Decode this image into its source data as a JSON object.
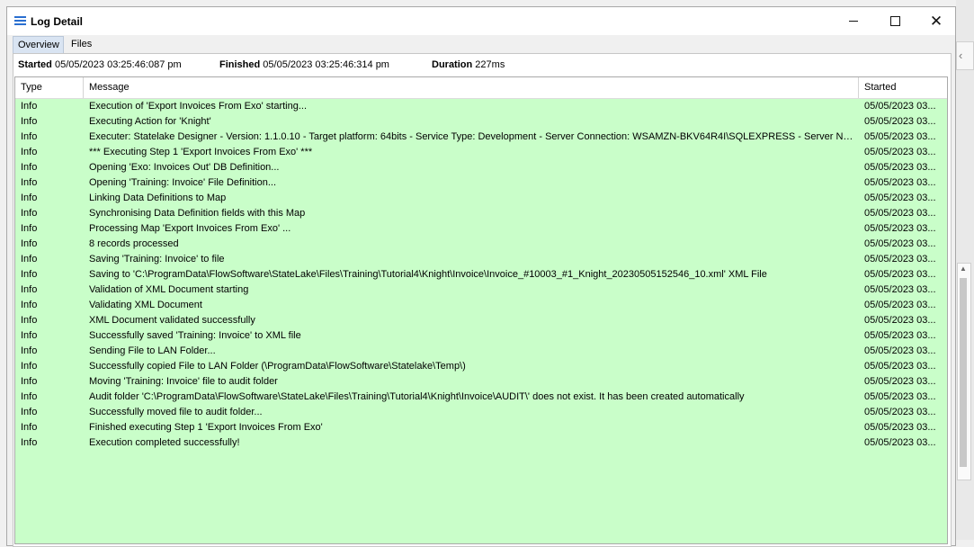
{
  "window": {
    "title": "Log Detail"
  },
  "tabs": [
    {
      "label": "Overview"
    },
    {
      "label": "Files"
    }
  ],
  "summary": {
    "started_label": "Started",
    "started_value": "05/05/2023 03:25:46:087 pm",
    "finished_label": "Finished",
    "finished_value": "05/05/2023 03:25:46:314 pm",
    "duration_label": "Duration",
    "duration_value": "227ms"
  },
  "grid": {
    "columns": [
      "Type",
      "Message",
      "Started"
    ],
    "row_color": "#c9fec9",
    "rows": [
      {
        "type": "Info",
        "message": "Execution of 'Export Invoices From Exo' starting...",
        "started": "05/05/2023 03..."
      },
      {
        "type": "Info",
        "message": "Executing Action for 'Knight'",
        "started": "05/05/2023 03..."
      },
      {
        "type": "Info",
        "message": "Executer: Statelake Designer - Version: 1.1.0.10 - Target platform:  64bits - Service Type: Development - Server Connection: WSAMZN-BKV64R4I\\SQLEXPRESS - Server Nam...",
        "started": "05/05/2023 03..."
      },
      {
        "type": "Info",
        "message": "*** Executing Step 1 'Export Invoices From Exo' ***",
        "started": "05/05/2023 03..."
      },
      {
        "type": "Info",
        "message": "Opening 'Exo: Invoices Out' DB Definition...",
        "started": "05/05/2023 03..."
      },
      {
        "type": "Info",
        "message": "Opening 'Training: Invoice' File Definition...",
        "started": "05/05/2023 03..."
      },
      {
        "type": "Info",
        "message": "Linking Data Definitions to Map",
        "started": "05/05/2023 03..."
      },
      {
        "type": "Info",
        "message": "Synchronising Data Definition fields with this Map",
        "started": "05/05/2023 03..."
      },
      {
        "type": "Info",
        "message": "Processing Map 'Export Invoices From Exo' ...",
        "started": "05/05/2023 03..."
      },
      {
        "type": "Info",
        "message": "8 records processed",
        "started": "05/05/2023 03..."
      },
      {
        "type": "Info",
        "message": "Saving 'Training: Invoice' to file",
        "started": "05/05/2023 03..."
      },
      {
        "type": "Info",
        "message": "Saving to 'C:\\ProgramData\\FlowSoftware\\StateLake\\Files\\Training\\Tutorial4\\Knight\\Invoice\\Invoice_#10003_#1_Knight_20230505152546_10.xml' XML File",
        "started": "05/05/2023 03..."
      },
      {
        "type": "Info",
        "message": "Validation of XML Document starting",
        "started": "05/05/2023 03..."
      },
      {
        "type": "Info",
        "message": "Validating XML Document",
        "started": "05/05/2023 03..."
      },
      {
        "type": "Info",
        "message": "XML Document validated successfully",
        "started": "05/05/2023 03..."
      },
      {
        "type": "Info",
        "message": "Successfully saved 'Training: Invoice' to XML file",
        "started": "05/05/2023 03..."
      },
      {
        "type": "Info",
        "message": "Sending File to LAN Folder...",
        "started": "05/05/2023 03..."
      },
      {
        "type": "Info",
        "message": "Successfully copied File to LAN Folder (\\ProgramData\\FlowSoftware\\Statelake\\Temp\\)",
        "started": "05/05/2023 03..."
      },
      {
        "type": "Info",
        "message": "Moving 'Training: Invoice' file to audit folder",
        "started": "05/05/2023 03..."
      },
      {
        "type": "Info",
        "message": "Audit folder 'C:\\ProgramData\\FlowSoftware\\StateLake\\Files\\Training\\Tutorial4\\Knight\\Invoice\\AUDIT\\' does not exist.  It has been created automatically",
        "started": "05/05/2023 03..."
      },
      {
        "type": "Info",
        "message": "Successfully moved file to audit folder...",
        "started": "05/05/2023 03..."
      },
      {
        "type": "Info",
        "message": "Finished executing Step 1 'Export Invoices From Exo'",
        "started": "05/05/2023 03..."
      },
      {
        "type": "Info",
        "message": "Execution completed successfully!",
        "started": "05/05/2023 03..."
      }
    ]
  },
  "icons": {
    "app": "menu-lines-icon",
    "minimize": "minimize-icon",
    "maximize": "maximize-icon",
    "close": "close-icon"
  }
}
